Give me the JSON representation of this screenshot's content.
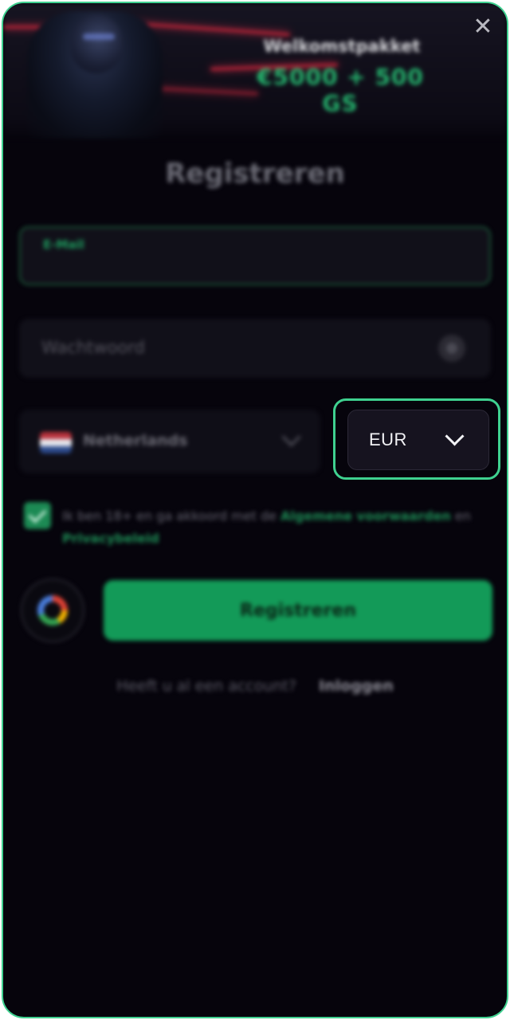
{
  "banner": {
    "title": "Welkomstpakket",
    "amount": "€5000 + 500 GS"
  },
  "close_icon": "close-icon",
  "form": {
    "title": "Registreren",
    "email_label": "E-Mail",
    "password_placeholder": "Wachtwoord",
    "country": "Netherlands",
    "currency": "EUR",
    "terms": {
      "text": "Ik ben 18+ en ga akkoord met de",
      "terms_link": "Algemene voorwaarden",
      "and": "en",
      "privacy_link": "Privacybeleid",
      "checked": true
    },
    "submit_label": "Registreren"
  },
  "login": {
    "question": "Heeft u al een account?",
    "link": "Inloggen"
  },
  "colors": {
    "accent": "#3fd190",
    "button": "#139a58",
    "background": "#06040c"
  }
}
